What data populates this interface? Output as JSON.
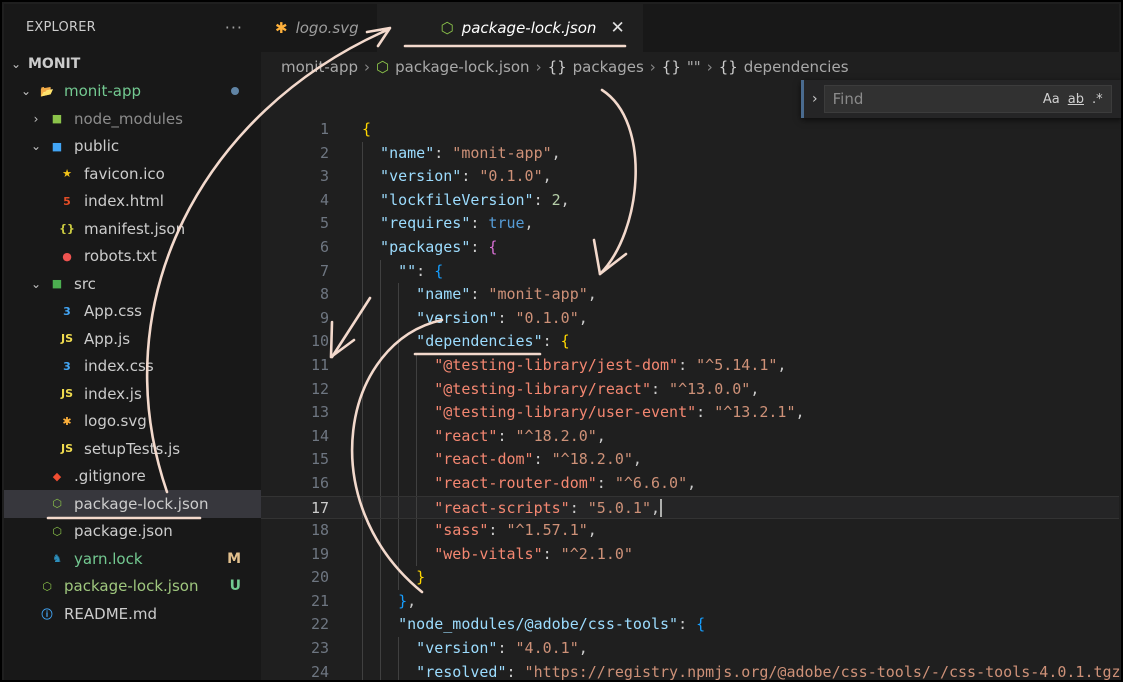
{
  "explorer": {
    "title": "EXPLORER",
    "more": "···",
    "root": "MONIT",
    "items": [
      {
        "label": "monit-app",
        "depth": 1,
        "chev": "⌄",
        "icon": "folder-icon",
        "cls": "modified",
        "dot": true
      },
      {
        "label": "node_modules",
        "depth": 2,
        "chev": "›",
        "icon": "folder-node-icon",
        "cls": "ignored"
      },
      {
        "label": "public",
        "depth": 2,
        "chev": "⌄",
        "icon": "folder-public-icon",
        "cls": ""
      },
      {
        "label": "favicon.ico",
        "depth": 3,
        "chev": "",
        "icon": "star-icon",
        "cls": ""
      },
      {
        "label": "index.html",
        "depth": 3,
        "chev": "",
        "icon": "html-icon",
        "cls": ""
      },
      {
        "label": "manifest.json",
        "depth": 3,
        "chev": "",
        "icon": "json-icon",
        "cls": ""
      },
      {
        "label": "robots.txt",
        "depth": 3,
        "chev": "",
        "icon": "robot-icon",
        "cls": ""
      },
      {
        "label": "src",
        "depth": 2,
        "chev": "⌄",
        "icon": "folder-src-icon",
        "cls": ""
      },
      {
        "label": "App.css",
        "depth": 3,
        "chev": "",
        "icon": "css-icon",
        "cls": ""
      },
      {
        "label": "App.js",
        "depth": 3,
        "chev": "",
        "icon": "js-icon",
        "cls": ""
      },
      {
        "label": "index.css",
        "depth": 3,
        "chev": "",
        "icon": "css-icon",
        "cls": ""
      },
      {
        "label": "index.js",
        "depth": 3,
        "chev": "",
        "icon": "js-icon",
        "cls": ""
      },
      {
        "label": "logo.svg",
        "depth": 3,
        "chev": "",
        "icon": "svg-icon",
        "cls": ""
      },
      {
        "label": "setupTests.js",
        "depth": 3,
        "chev": "",
        "icon": "js-icon",
        "cls": ""
      },
      {
        "label": ".gitignore",
        "depth": 2,
        "chev": "",
        "icon": "git-icon",
        "cls": ""
      },
      {
        "label": "package-lock.json",
        "depth": 2,
        "chev": "",
        "icon": "node-icon",
        "cls": "",
        "selected": true
      },
      {
        "label": "package.json",
        "depth": 2,
        "chev": "",
        "icon": "node-icon",
        "cls": ""
      },
      {
        "label": "yarn.lock",
        "depth": 2,
        "chev": "",
        "icon": "yarn-icon",
        "cls": "modified",
        "badge": "M",
        "badgeColor": "#e2c08d"
      },
      {
        "label": "package-lock.json",
        "depth": 1,
        "chev": "",
        "icon": "node-icon",
        "cls": "green",
        "badge": "U",
        "badgeColor": "#73c991"
      },
      {
        "label": "README.md",
        "depth": 1,
        "chev": "",
        "icon": "info-icon",
        "cls": ""
      }
    ]
  },
  "tabs": [
    {
      "label": "logo.svg",
      "icon": "svg-icon",
      "active": false
    },
    {
      "label": "package-lock.json",
      "icon": "node-icon",
      "active": true,
      "close": "✕"
    }
  ],
  "breadcrumb": [
    "monit-app",
    "package-lock.json",
    "packages",
    "\"\"",
    "dependencies"
  ],
  "find": {
    "placeholder": "Find",
    "opt_case": "Aa",
    "opt_word": "ab",
    "opt_regex": ".*",
    "trail": "N"
  },
  "colors": {
    "accent": "#4a6b8f",
    "modified": "#73c991",
    "badge_m": "#e2c08d",
    "annotation": "#f3d9cc"
  },
  "code": {
    "current_line": 17,
    "lines": [
      {
        "n": 1,
        "i": 0,
        "t": [
          [
            "b1",
            "{"
          ]
        ]
      },
      {
        "n": 2,
        "i": 1,
        "t": [
          [
            "propK",
            "\"name\""
          ],
          [
            "p",
            ": "
          ],
          [
            "str",
            "\"monit-app\""
          ],
          [
            "p",
            ","
          ]
        ]
      },
      {
        "n": 3,
        "i": 1,
        "t": [
          [
            "propK",
            "\"version\""
          ],
          [
            "p",
            ": "
          ],
          [
            "str",
            "\"0.1.0\""
          ],
          [
            "p",
            ","
          ]
        ]
      },
      {
        "n": 4,
        "i": 1,
        "t": [
          [
            "propK",
            "\"lockfileVersion\""
          ],
          [
            "p",
            ": "
          ],
          [
            "num",
            "2"
          ],
          [
            "p",
            ","
          ]
        ]
      },
      {
        "n": 5,
        "i": 1,
        "t": [
          [
            "propK",
            "\"requires\""
          ],
          [
            "p",
            ": "
          ],
          [
            "bool",
            "true"
          ],
          [
            "p",
            ","
          ]
        ]
      },
      {
        "n": 6,
        "i": 1,
        "t": [
          [
            "propK",
            "\"packages\""
          ],
          [
            "p",
            ": "
          ],
          [
            "b2",
            "{"
          ]
        ]
      },
      {
        "n": 7,
        "i": 2,
        "t": [
          [
            "propK",
            "\"\""
          ],
          [
            "p",
            ": "
          ],
          [
            "b3",
            "{"
          ]
        ]
      },
      {
        "n": 8,
        "i": 3,
        "t": [
          [
            "propK",
            "\"name\""
          ],
          [
            "p",
            ": "
          ],
          [
            "str",
            "\"monit-app\""
          ],
          [
            "p",
            ","
          ]
        ]
      },
      {
        "n": 9,
        "i": 3,
        "t": [
          [
            "propK",
            "\"version\""
          ],
          [
            "p",
            ": "
          ],
          [
            "str",
            "\"0.1.0\""
          ],
          [
            "p",
            ","
          ]
        ]
      },
      {
        "n": 10,
        "i": 3,
        "t": [
          [
            "propK",
            "\"dependencies\""
          ],
          [
            "p",
            ": "
          ],
          [
            "b1",
            "{"
          ]
        ]
      },
      {
        "n": 11,
        "i": 4,
        "t": [
          [
            "depK",
            "\"@testing-library/jest-dom\""
          ],
          [
            "p",
            ": "
          ],
          [
            "str",
            "\"^5.14.1\""
          ],
          [
            "p",
            ","
          ]
        ]
      },
      {
        "n": 12,
        "i": 4,
        "t": [
          [
            "depK",
            "\"@testing-library/react\""
          ],
          [
            "p",
            ": "
          ],
          [
            "str",
            "\"^13.0.0\""
          ],
          [
            "p",
            ","
          ]
        ]
      },
      {
        "n": 13,
        "i": 4,
        "t": [
          [
            "depK",
            "\"@testing-library/user-event\""
          ],
          [
            "p",
            ": "
          ],
          [
            "str",
            "\"^13.2.1\""
          ],
          [
            "p",
            ","
          ]
        ]
      },
      {
        "n": 14,
        "i": 4,
        "t": [
          [
            "depK",
            "\"react\""
          ],
          [
            "p",
            ": "
          ],
          [
            "str",
            "\"^18.2.0\""
          ],
          [
            "p",
            ","
          ]
        ]
      },
      {
        "n": 15,
        "i": 4,
        "t": [
          [
            "depK",
            "\"react-dom\""
          ],
          [
            "p",
            ": "
          ],
          [
            "str",
            "\"^18.2.0\""
          ],
          [
            "p",
            ","
          ]
        ]
      },
      {
        "n": 16,
        "i": 4,
        "t": [
          [
            "depK",
            "\"react-router-dom\""
          ],
          [
            "p",
            ": "
          ],
          [
            "str",
            "\"^6.6.0\""
          ],
          [
            "p",
            ","
          ]
        ]
      },
      {
        "n": 17,
        "i": 4,
        "t": [
          [
            "depK",
            "\"react-scripts\""
          ],
          [
            "p",
            ": "
          ],
          [
            "str",
            "\"5.0.1\""
          ],
          [
            "p",
            ","
          ]
        ]
      },
      {
        "n": 18,
        "i": 4,
        "t": [
          [
            "depK",
            "\"sass\""
          ],
          [
            "p",
            ": "
          ],
          [
            "str",
            "\"^1.57.1\""
          ],
          [
            "p",
            ","
          ]
        ]
      },
      {
        "n": 19,
        "i": 4,
        "t": [
          [
            "depK",
            "\"web-vitals\""
          ],
          [
            "p",
            ": "
          ],
          [
            "str",
            "\"^2.1.0\""
          ]
        ]
      },
      {
        "n": 20,
        "i": 3,
        "t": [
          [
            "b1",
            "}"
          ]
        ]
      },
      {
        "n": 21,
        "i": 2,
        "t": [
          [
            "b3",
            "}"
          ],
          [
            "p",
            ","
          ]
        ]
      },
      {
        "n": 22,
        "i": 2,
        "t": [
          [
            "propK",
            "\"node_modules/@adobe/css-tools\""
          ],
          [
            "p",
            ": "
          ],
          [
            "b3",
            "{"
          ]
        ]
      },
      {
        "n": 23,
        "i": 3,
        "t": [
          [
            "propK",
            "\"version\""
          ],
          [
            "p",
            ": "
          ],
          [
            "str",
            "\"4.0.1\""
          ],
          [
            "p",
            ","
          ]
        ]
      },
      {
        "n": 24,
        "i": 3,
        "t": [
          [
            "propK",
            "\"resolved\""
          ],
          [
            "p",
            ": "
          ],
          [
            "str",
            "\"https://registry.npmjs.org/@adobe/css-tools/-/css-tools-4.0.1.tgz\""
          ],
          [
            "p",
            ","
          ]
        ]
      }
    ]
  }
}
